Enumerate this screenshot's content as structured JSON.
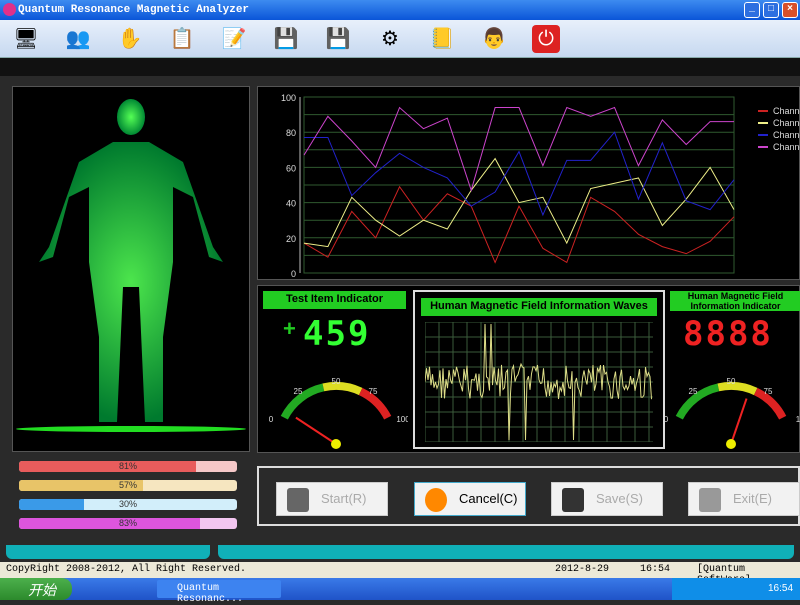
{
  "window": {
    "title": "Quantum Resonance Magnetic Analyzer"
  },
  "toolbar": {
    "icons": [
      "computer-user-icon",
      "users-icon",
      "hand-icon",
      "report-icon",
      "edit-report-icon",
      "import-icon",
      "export-icon",
      "settings-gears-icon",
      "help-book-icon",
      "doctor-icon",
      "power-icon"
    ]
  },
  "chart_data": {
    "type": "line",
    "ylim": [
      0,
      100
    ],
    "yticks": [
      "0",
      "20",
      "40",
      "60",
      "80",
      "100"
    ],
    "grid": true,
    "legend_position": "right",
    "series": [
      {
        "name": "Channe",
        "color": "#cc2222",
        "values": [
          17,
          9,
          35,
          20,
          49,
          30,
          45,
          38,
          6,
          38,
          14,
          6,
          43,
          35,
          22,
          15,
          11,
          18,
          32
        ]
      },
      {
        "name": "Channe",
        "color": "#eeee88",
        "values": [
          17,
          15,
          43,
          30,
          21,
          30,
          25,
          47,
          65,
          40,
          43,
          17,
          48,
          51,
          54,
          27,
          42,
          60,
          36
        ]
      },
      {
        "name": "Channe",
        "color": "#2222cc",
        "values": [
          77,
          77,
          44,
          57,
          68,
          60,
          54,
          38,
          46,
          69,
          33,
          64,
          64,
          80,
          42,
          74,
          41,
          36,
          53
        ]
      },
      {
        "name": "Channe",
        "color": "#cc44cc",
        "values": [
          67,
          89,
          75,
          60,
          94,
          82,
          88,
          47,
          94,
          94,
          61,
          94,
          89,
          94,
          61,
          87,
          73,
          86,
          86
        ]
      }
    ]
  },
  "test_indicator": {
    "title": "Test Item Indicator",
    "sign": "+",
    "digits": "459",
    "gauge_labels": [
      "0",
      "25",
      "50",
      "75",
      "100"
    ],
    "gauge_value": 5
  },
  "waves": {
    "title": "Human Magnetic Field Information Waves"
  },
  "field_indicator": {
    "title": "Human Magnetic Field Information Indicator",
    "digits": "8888",
    "gauge_labels": [
      "0",
      "25",
      "50",
      "75",
      "1"
    ],
    "gauge_value": 65
  },
  "bars": [
    {
      "label": "81%",
      "value": 81,
      "color": "#e85c5c",
      "bg": "#f5c8c8"
    },
    {
      "label": "57%",
      "value": 57,
      "color": "#e8c468",
      "bg": "#f6e6c0"
    },
    {
      "label": "30%",
      "value": 30,
      "color": "#3a9ae8",
      "bg": "#d2eefa"
    },
    {
      "label": "83%",
      "value": 83,
      "color": "#dd55dd",
      "bg": "#f3c6f0"
    }
  ],
  "buttons": {
    "start": "Start(R)",
    "cancel": "Cancel(C)",
    "save": "Save(S)",
    "exit": "Exit(E)"
  },
  "status": {
    "copyright": "CopyRight 2008-2012, All Right Reserved.",
    "date": "2012-8-29",
    "time": "16:54",
    "brand": "[Quantum SoftWare]"
  },
  "taskbar": {
    "start": "开始",
    "task": "Quantum Resonanc...",
    "clock": "16:54"
  }
}
